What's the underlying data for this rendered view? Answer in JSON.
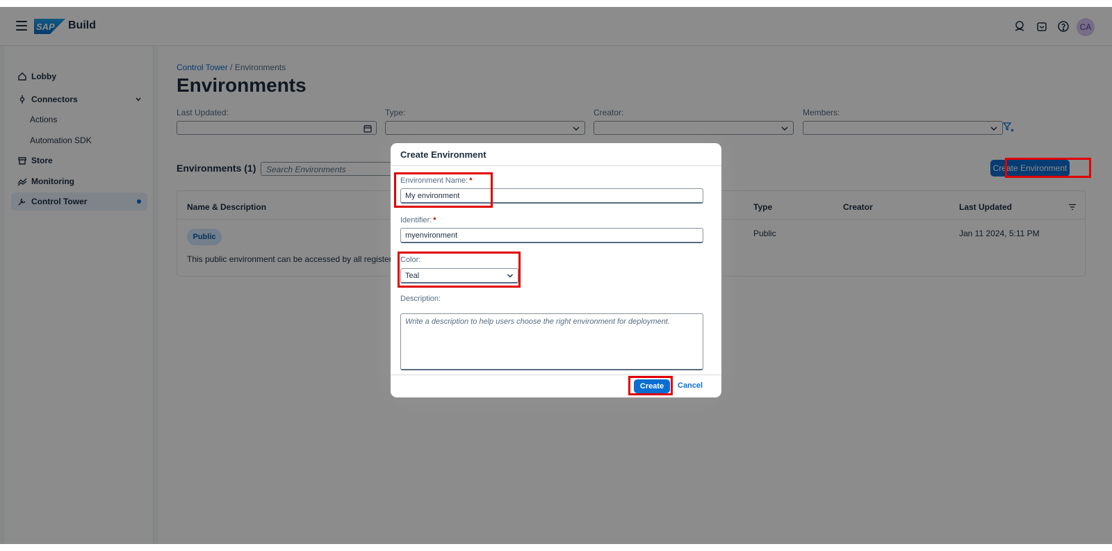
{
  "shell": {
    "app_name": "Build",
    "logo_text": "SAP",
    "avatar_initials": "CA"
  },
  "sidebar": {
    "items": [
      {
        "label": "Lobby",
        "icon": "home-icon"
      },
      {
        "label": "Connectors",
        "icon": "connector-icon"
      },
      {
        "label": "Actions"
      },
      {
        "label": "Automation SDK"
      },
      {
        "label": "Store",
        "icon": "store-icon"
      },
      {
        "label": "Monitoring",
        "icon": "monitoring-icon"
      },
      {
        "label": "Control Tower",
        "icon": "tools-icon",
        "active": true
      }
    ]
  },
  "main": {
    "breadcrumb": {
      "link": "Control Tower",
      "separator": "/",
      "current": "Environments"
    },
    "title": "Environments",
    "filters": [
      {
        "label": "Last Updated:"
      },
      {
        "label": "Type:"
      },
      {
        "label": "Creator:"
      },
      {
        "label": "Members:"
      }
    ],
    "list_title": "Environments (1)",
    "search_placeholder": "Search Environments",
    "create_button": "Create Environment",
    "table": {
      "columns": [
        "Name & Description",
        "Type",
        "Creator",
        "Last Updated"
      ],
      "rows": [
        {
          "badge": "Public",
          "description": "This public environment can be accessed by all registered",
          "type": "Public",
          "creator": "",
          "last_updated": "Jan 11 2024, 5:11 PM"
        }
      ]
    }
  },
  "dialog": {
    "title": "Create Environment",
    "name_label": "Environment Name:",
    "name_value": "My environment",
    "identifier_label": "Identifier:",
    "identifier_value": "myenvironment",
    "required_mark": "*",
    "color_label": "Color:",
    "color_value": "Teal",
    "description_label": "Description:",
    "description_placeholder": "Write a description to help users choose the right environment for deployment.",
    "create_button": "Create",
    "cancel_button": "Cancel"
  },
  "colors": {
    "accent": "#0a6ed1",
    "highlight": "#e00000",
    "required": "#bb0000"
  }
}
